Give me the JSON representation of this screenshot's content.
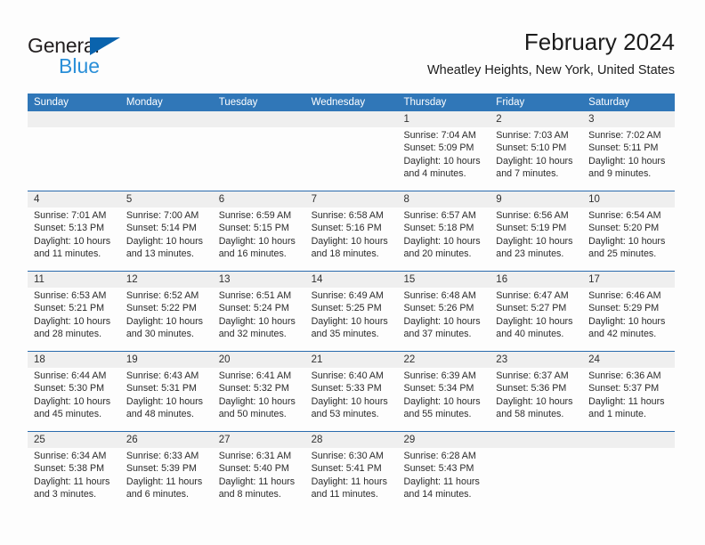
{
  "brand": {
    "name_part1": "General",
    "name_part2": "Blue",
    "triangle_icon": "triangle-logo-icon",
    "colors": {
      "dark": "#231f20",
      "blue": "#2a8fd8",
      "triangle": "#0a63ad"
    }
  },
  "header": {
    "title": "February 2024",
    "location": "Wheatley Heights, New York, United States"
  },
  "theme": {
    "header_blue": "#3077b8",
    "row_divider_blue": "#2a6bad",
    "date_band_gray": "#efefef",
    "page_background": "#fdfdfd",
    "text": "#2b2b2b"
  },
  "calendar": {
    "columns": [
      "Sunday",
      "Monday",
      "Tuesday",
      "Wednesday",
      "Thursday",
      "Friday",
      "Saturday"
    ],
    "weeks": [
      [
        {
          "day": ""
        },
        {
          "day": ""
        },
        {
          "day": ""
        },
        {
          "day": ""
        },
        {
          "day": "1",
          "sunrise": "Sunrise: 7:04 AM",
          "sunset": "Sunset: 5:09 PM",
          "daylight1": "Daylight: 10 hours",
          "daylight2": "and 4 minutes."
        },
        {
          "day": "2",
          "sunrise": "Sunrise: 7:03 AM",
          "sunset": "Sunset: 5:10 PM",
          "daylight1": "Daylight: 10 hours",
          "daylight2": "and 7 minutes."
        },
        {
          "day": "3",
          "sunrise": "Sunrise: 7:02 AM",
          "sunset": "Sunset: 5:11 PM",
          "daylight1": "Daylight: 10 hours",
          "daylight2": "and 9 minutes."
        }
      ],
      [
        {
          "day": "4",
          "sunrise": "Sunrise: 7:01 AM",
          "sunset": "Sunset: 5:13 PM",
          "daylight1": "Daylight: 10 hours",
          "daylight2": "and 11 minutes."
        },
        {
          "day": "5",
          "sunrise": "Sunrise: 7:00 AM",
          "sunset": "Sunset: 5:14 PM",
          "daylight1": "Daylight: 10 hours",
          "daylight2": "and 13 minutes."
        },
        {
          "day": "6",
          "sunrise": "Sunrise: 6:59 AM",
          "sunset": "Sunset: 5:15 PM",
          "daylight1": "Daylight: 10 hours",
          "daylight2": "and 16 minutes."
        },
        {
          "day": "7",
          "sunrise": "Sunrise: 6:58 AM",
          "sunset": "Sunset: 5:16 PM",
          "daylight1": "Daylight: 10 hours",
          "daylight2": "and 18 minutes."
        },
        {
          "day": "8",
          "sunrise": "Sunrise: 6:57 AM",
          "sunset": "Sunset: 5:18 PM",
          "daylight1": "Daylight: 10 hours",
          "daylight2": "and 20 minutes."
        },
        {
          "day": "9",
          "sunrise": "Sunrise: 6:56 AM",
          "sunset": "Sunset: 5:19 PM",
          "daylight1": "Daylight: 10 hours",
          "daylight2": "and 23 minutes."
        },
        {
          "day": "10",
          "sunrise": "Sunrise: 6:54 AM",
          "sunset": "Sunset: 5:20 PM",
          "daylight1": "Daylight: 10 hours",
          "daylight2": "and 25 minutes."
        }
      ],
      [
        {
          "day": "11",
          "sunrise": "Sunrise: 6:53 AM",
          "sunset": "Sunset: 5:21 PM",
          "daylight1": "Daylight: 10 hours",
          "daylight2": "and 28 minutes."
        },
        {
          "day": "12",
          "sunrise": "Sunrise: 6:52 AM",
          "sunset": "Sunset: 5:22 PM",
          "daylight1": "Daylight: 10 hours",
          "daylight2": "and 30 minutes."
        },
        {
          "day": "13",
          "sunrise": "Sunrise: 6:51 AM",
          "sunset": "Sunset: 5:24 PM",
          "daylight1": "Daylight: 10 hours",
          "daylight2": "and 32 minutes."
        },
        {
          "day": "14",
          "sunrise": "Sunrise: 6:49 AM",
          "sunset": "Sunset: 5:25 PM",
          "daylight1": "Daylight: 10 hours",
          "daylight2": "and 35 minutes."
        },
        {
          "day": "15",
          "sunrise": "Sunrise: 6:48 AM",
          "sunset": "Sunset: 5:26 PM",
          "daylight1": "Daylight: 10 hours",
          "daylight2": "and 37 minutes."
        },
        {
          "day": "16",
          "sunrise": "Sunrise: 6:47 AM",
          "sunset": "Sunset: 5:27 PM",
          "daylight1": "Daylight: 10 hours",
          "daylight2": "and 40 minutes."
        },
        {
          "day": "17",
          "sunrise": "Sunrise: 6:46 AM",
          "sunset": "Sunset: 5:29 PM",
          "daylight1": "Daylight: 10 hours",
          "daylight2": "and 42 minutes."
        }
      ],
      [
        {
          "day": "18",
          "sunrise": "Sunrise: 6:44 AM",
          "sunset": "Sunset: 5:30 PM",
          "daylight1": "Daylight: 10 hours",
          "daylight2": "and 45 minutes."
        },
        {
          "day": "19",
          "sunrise": "Sunrise: 6:43 AM",
          "sunset": "Sunset: 5:31 PM",
          "daylight1": "Daylight: 10 hours",
          "daylight2": "and 48 minutes."
        },
        {
          "day": "20",
          "sunrise": "Sunrise: 6:41 AM",
          "sunset": "Sunset: 5:32 PM",
          "daylight1": "Daylight: 10 hours",
          "daylight2": "and 50 minutes."
        },
        {
          "day": "21",
          "sunrise": "Sunrise: 6:40 AM",
          "sunset": "Sunset: 5:33 PM",
          "daylight1": "Daylight: 10 hours",
          "daylight2": "and 53 minutes."
        },
        {
          "day": "22",
          "sunrise": "Sunrise: 6:39 AM",
          "sunset": "Sunset: 5:34 PM",
          "daylight1": "Daylight: 10 hours",
          "daylight2": "and 55 minutes."
        },
        {
          "day": "23",
          "sunrise": "Sunrise: 6:37 AM",
          "sunset": "Sunset: 5:36 PM",
          "daylight1": "Daylight: 10 hours",
          "daylight2": "and 58 minutes."
        },
        {
          "day": "24",
          "sunrise": "Sunrise: 6:36 AM",
          "sunset": "Sunset: 5:37 PM",
          "daylight1": "Daylight: 11 hours",
          "daylight2": "and 1 minute."
        }
      ],
      [
        {
          "day": "25",
          "sunrise": "Sunrise: 6:34 AM",
          "sunset": "Sunset: 5:38 PM",
          "daylight1": "Daylight: 11 hours",
          "daylight2": "and 3 minutes."
        },
        {
          "day": "26",
          "sunrise": "Sunrise: 6:33 AM",
          "sunset": "Sunset: 5:39 PM",
          "daylight1": "Daylight: 11 hours",
          "daylight2": "and 6 minutes."
        },
        {
          "day": "27",
          "sunrise": "Sunrise: 6:31 AM",
          "sunset": "Sunset: 5:40 PM",
          "daylight1": "Daylight: 11 hours",
          "daylight2": "and 8 minutes."
        },
        {
          "day": "28",
          "sunrise": "Sunrise: 6:30 AM",
          "sunset": "Sunset: 5:41 PM",
          "daylight1": "Daylight: 11 hours",
          "daylight2": "and 11 minutes."
        },
        {
          "day": "29",
          "sunrise": "Sunrise: 6:28 AM",
          "sunset": "Sunset: 5:43 PM",
          "daylight1": "Daylight: 11 hours",
          "daylight2": "and 14 minutes."
        },
        {
          "day": ""
        },
        {
          "day": ""
        }
      ]
    ]
  }
}
